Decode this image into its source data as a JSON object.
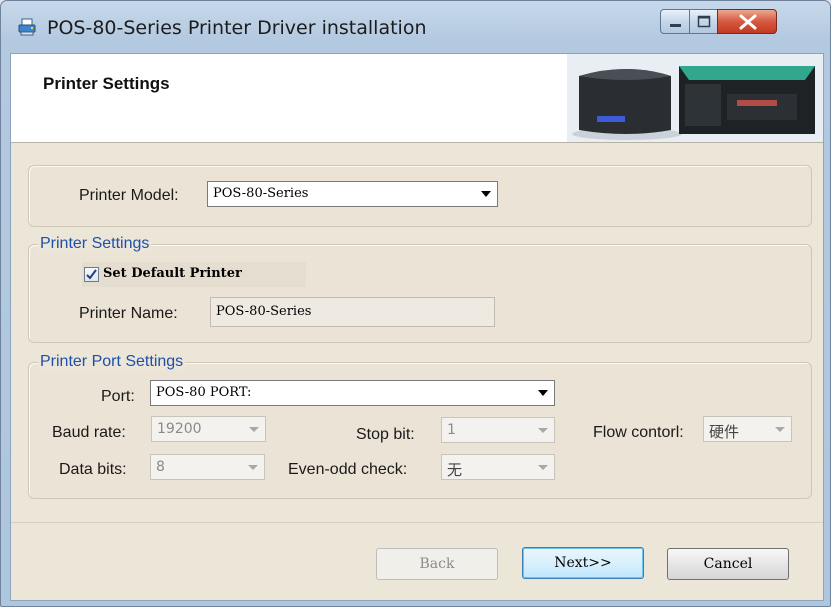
{
  "window": {
    "title": "POS-80-Series Printer Driver installation",
    "controls": [
      "minimize",
      "maximize",
      "close"
    ]
  },
  "header": {
    "title": "Printer Settings",
    "image": "printer-photo"
  },
  "model_group": {
    "label": "Printer Model:",
    "value": "POS-80-Series"
  },
  "printer_settings": {
    "group_label": "Printer Settings",
    "default_checkbox_label": "Set Default Printer",
    "default_checked": true,
    "name_label": "Printer Name:",
    "name_value": "POS-80-Series"
  },
  "port_settings": {
    "group_label": "Printer Port Settings",
    "port_label": "Port:",
    "port_value": "POS-80 PORT:",
    "baud_label": "Baud rate:",
    "baud_value": "19200",
    "stop_label": "Stop bit:",
    "stop_value": "1",
    "flow_label": "Flow contorl:",
    "flow_value": "硬件",
    "data_label": "Data bits:",
    "data_value": "8",
    "parity_label": "Even-odd check:",
    "parity_value": "无"
  },
  "buttons": {
    "back": "Back",
    "next": "Next>>",
    "cancel": "Cancel"
  },
  "colors": {
    "group_label": "#1f4fa8",
    "client_bg": "#ece6d9",
    "close_button": "#c23a21"
  }
}
